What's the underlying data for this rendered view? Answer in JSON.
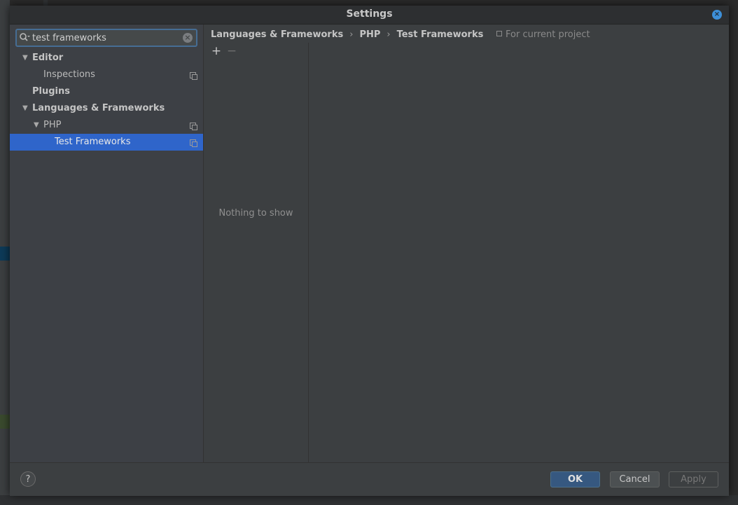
{
  "dialog": {
    "title": "Settings"
  },
  "search": {
    "value": "test frameworks"
  },
  "tree": [
    {
      "label": "Editor",
      "bold": true,
      "level": 0,
      "expanded": true,
      "copy_icon": false,
      "selected": false
    },
    {
      "label": "Inspections",
      "bold": false,
      "level": 1,
      "expanded": null,
      "copy_icon": true,
      "selected": false
    },
    {
      "label": "Plugins",
      "bold": true,
      "level": 0,
      "expanded": null,
      "copy_icon": false,
      "selected": false
    },
    {
      "label": "Languages & Frameworks",
      "bold": true,
      "level": 0,
      "expanded": true,
      "copy_icon": false,
      "selected": false
    },
    {
      "label": "PHP",
      "bold": false,
      "level": 1,
      "expanded": true,
      "copy_icon": true,
      "selected": false
    },
    {
      "label": "Test Frameworks",
      "bold": false,
      "level": 2,
      "expanded": null,
      "copy_icon": true,
      "selected": true
    }
  ],
  "breadcrumb": [
    "Languages & Frameworks",
    "PHP",
    "Test Frameworks"
  ],
  "scope_label": "For current project",
  "toolbar": {
    "add": "+",
    "remove": "−"
  },
  "empty_text": "Nothing to show",
  "footer": {
    "help": "?",
    "ok": "OK",
    "cancel": "Cancel",
    "apply": "Apply"
  },
  "colors": {
    "selection": "#2f65ca",
    "ok_button": "#365880",
    "close_button": "#3d8fd8"
  }
}
